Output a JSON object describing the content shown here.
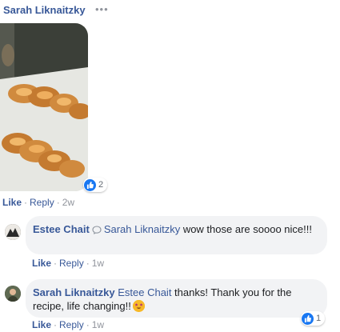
{
  "post": {
    "author": "Sarah Liknaitzky",
    "more_label": "•••",
    "photo_alt": "two braided challah loaves on baking paper",
    "reaction_count": "2",
    "actions": {
      "like": "Like",
      "reply": "Reply",
      "time": "2w",
      "sep": "·"
    }
  },
  "comments": [
    {
      "author": "Estee Chait",
      "mention": "Sarah Liknaitzky",
      "text": " wow those are soooo nice!!!",
      "actions": {
        "like": "Like",
        "reply": "Reply",
        "time": "1w",
        "sep": "·"
      }
    },
    {
      "author": "Sarah Liknaitzky",
      "mention": "Estee Chait",
      "text": " thanks! Thank you for the recipe, life changing!!",
      "emoji_icon": "star-struck-emoji-icon",
      "reaction_count": "1",
      "actions": {
        "like": "Like",
        "reply": "Reply",
        "time": "1w",
        "sep": "·"
      }
    }
  ],
  "colors": {
    "link": "#385898",
    "meta": "#90949c",
    "bubble": "#f2f3f5",
    "like_blue": "#1877f2"
  }
}
